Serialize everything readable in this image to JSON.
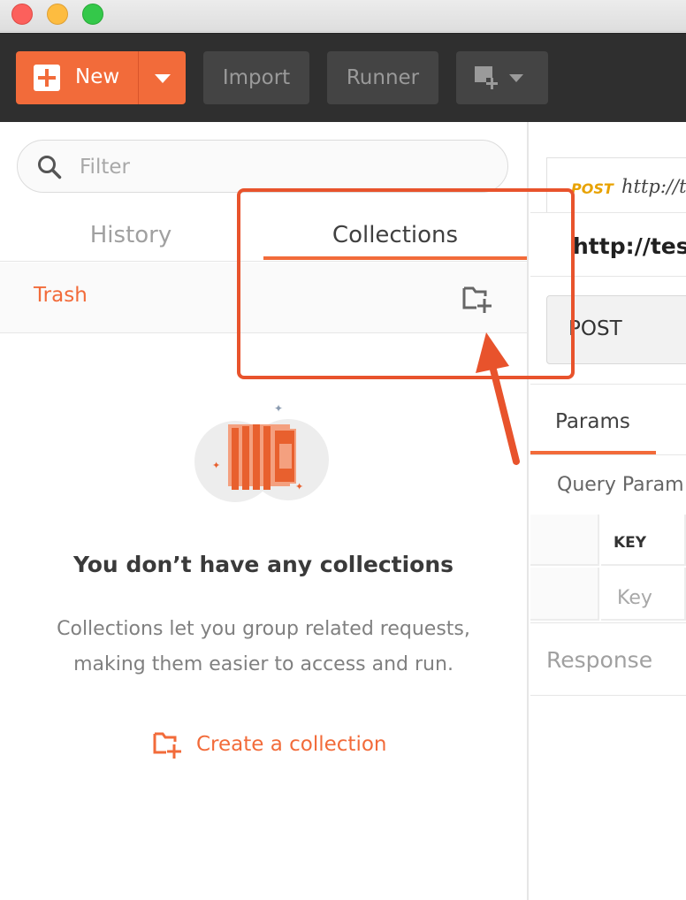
{
  "toolbar": {
    "new_label": "New",
    "import_label": "Import",
    "runner_label": "Runner"
  },
  "sidebar": {
    "search": {
      "placeholder": "Filter"
    },
    "tabs": [
      {
        "label": "History",
        "active": false
      },
      {
        "label": "Collections",
        "active": true
      }
    ],
    "trash_label": "Trash",
    "empty_state": {
      "title": "You don’t have any collections",
      "description": "Collections let you group related requests, making them easier to access and run.",
      "create_label": "Create a collection"
    }
  },
  "main": {
    "request_tab": {
      "method": "POST",
      "url": "http://te"
    },
    "request_heading": "http://test",
    "method_value": "POST",
    "params_tab_label": "Params",
    "query_params_label": "Query Param",
    "key_header": "KEY",
    "key_placeholder": "Key",
    "response_label": "Response"
  },
  "colors": {
    "accent": "#f26b3a",
    "toolbar_bg": "#2f2f2f",
    "annotation": "#e8532c",
    "method_post": "#e8a200"
  },
  "icons": [
    "plus-icon",
    "caret-down-icon",
    "new-window-icon",
    "search-icon",
    "new-collection-icon",
    "collection-illustration",
    "create-collection-icon"
  ]
}
